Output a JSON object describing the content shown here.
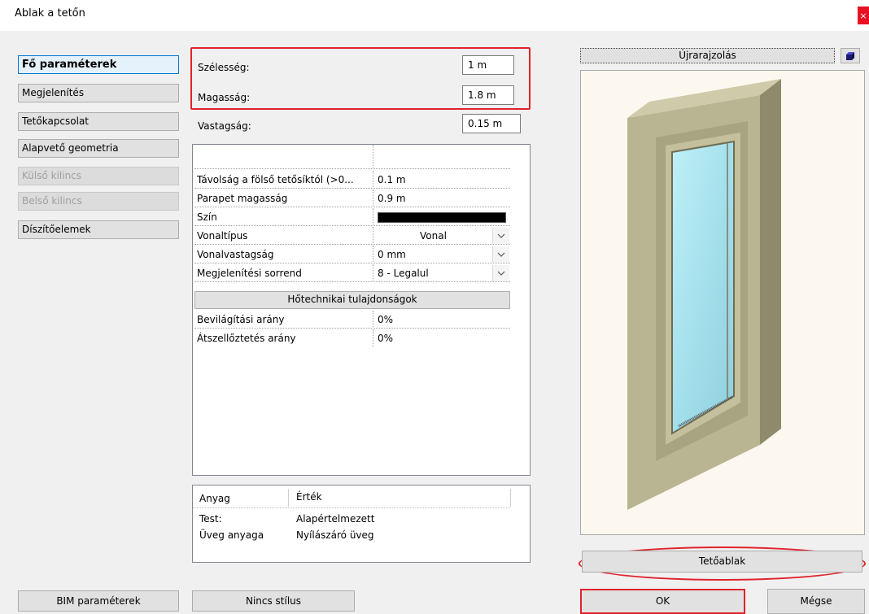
{
  "window": {
    "title": "Ablak a tetőn",
    "close_symbol": "×"
  },
  "nav": {
    "items": [
      {
        "label": "Fő paraméterek",
        "state": "active"
      },
      {
        "label": "Megjelenítés",
        "state": "normal"
      },
      {
        "label": "Tetőkapcsolat",
        "state": "normal"
      },
      {
        "label": "Alapvető geometria",
        "state": "normal"
      },
      {
        "label": "Külső kilincs",
        "state": "disabled"
      },
      {
        "label": "Belső kilincs",
        "state": "disabled"
      },
      {
        "label": "Díszítőelemek",
        "state": "normal"
      }
    ],
    "bim_button": "BIM paraméterek"
  },
  "dims": {
    "width_label": "Szélesség:",
    "width_value": "1 m",
    "height_label": "Magasság:",
    "height_value": "1.8 m",
    "thickness_label": "Vastagság:",
    "thickness_value": "0.15 m"
  },
  "props": {
    "rows": [
      {
        "label": "Távolság a fölső tetősíktól (>0...",
        "value": "0.1 m"
      },
      {
        "label": "Parapet magasság",
        "value": "0.9 m"
      },
      {
        "label": "Szín",
        "value": "",
        "swatch": "#000000"
      },
      {
        "label": "Vonaltípus",
        "value": "Vonal",
        "dropdown": true
      },
      {
        "label": "Vonalvastagság",
        "value": "0 mm",
        "dropdown": true
      },
      {
        "label": "Megjelenítési sorrend",
        "value": "8 - Legalul",
        "dropdown": true
      }
    ],
    "section_button": "Hőtechnikai tulajdonságok",
    "rows2": [
      {
        "label": "Bevilágítási arány",
        "value": "0%"
      },
      {
        "label": "Átszellőztetés arány",
        "value": "0%"
      }
    ],
    "dropdown_icon": "chevron-down-icon"
  },
  "materials": {
    "header_material": "Anyag",
    "header_value": "Érték",
    "rows": [
      {
        "material": "Test:",
        "value": "Alapértelmezett"
      },
      {
        "material": "Üveg anyaga",
        "value": "Nyílászáró üveg"
      }
    ]
  },
  "style_button": "Nincs stílus",
  "preview": {
    "redraw_button": "Újrarajzolás",
    "view_icon": "cube-icon",
    "type_button": "Tetőablak"
  },
  "footer": {
    "ok": "OK",
    "cancel": "Mégse"
  },
  "colors": {
    "highlight": "#e0242c",
    "active_border": "#0078d7",
    "frame": "#b3ae8c",
    "glass": "#a6e2ee"
  }
}
